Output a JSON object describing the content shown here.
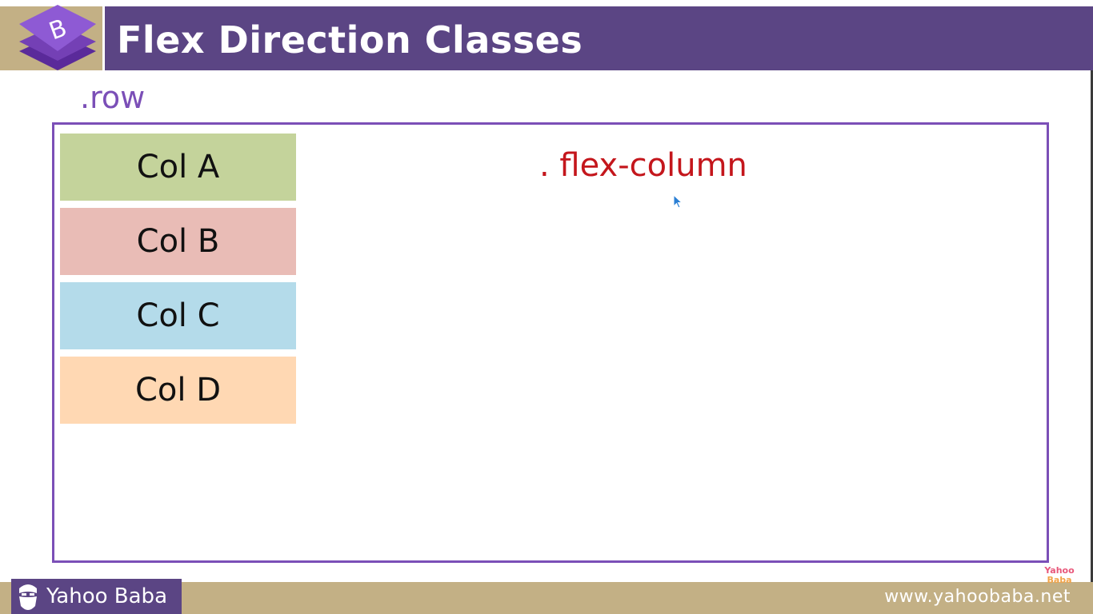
{
  "slide": {
    "title": "Flex Direction Classes",
    "row_label": ".row",
    "class_label": ". flex-column",
    "columns": [
      {
        "label": "Col A",
        "color": "#c4d39b"
      },
      {
        "label": "Col B",
        "color": "#e9bcb6"
      },
      {
        "label": "Col C",
        "color": "#b4dbea"
      },
      {
        "label": "Col D",
        "color": "#ffd8b3"
      }
    ]
  },
  "branding": {
    "logo_icon": "bootstrap-logo-icon",
    "brand_name": "Yahoo Baba",
    "brand_icon": "bearded-man-icon",
    "website": "www.yahoobaba.net",
    "watermark_line1": "Yahoo",
    "watermark_line2": "Baba"
  },
  "colors": {
    "title_bar": "#5b4584",
    "accent_bar": "#c3b085",
    "row_label": "#7b4fb7",
    "container_border": "#7b4fb7",
    "class_label": "#c4161c"
  }
}
